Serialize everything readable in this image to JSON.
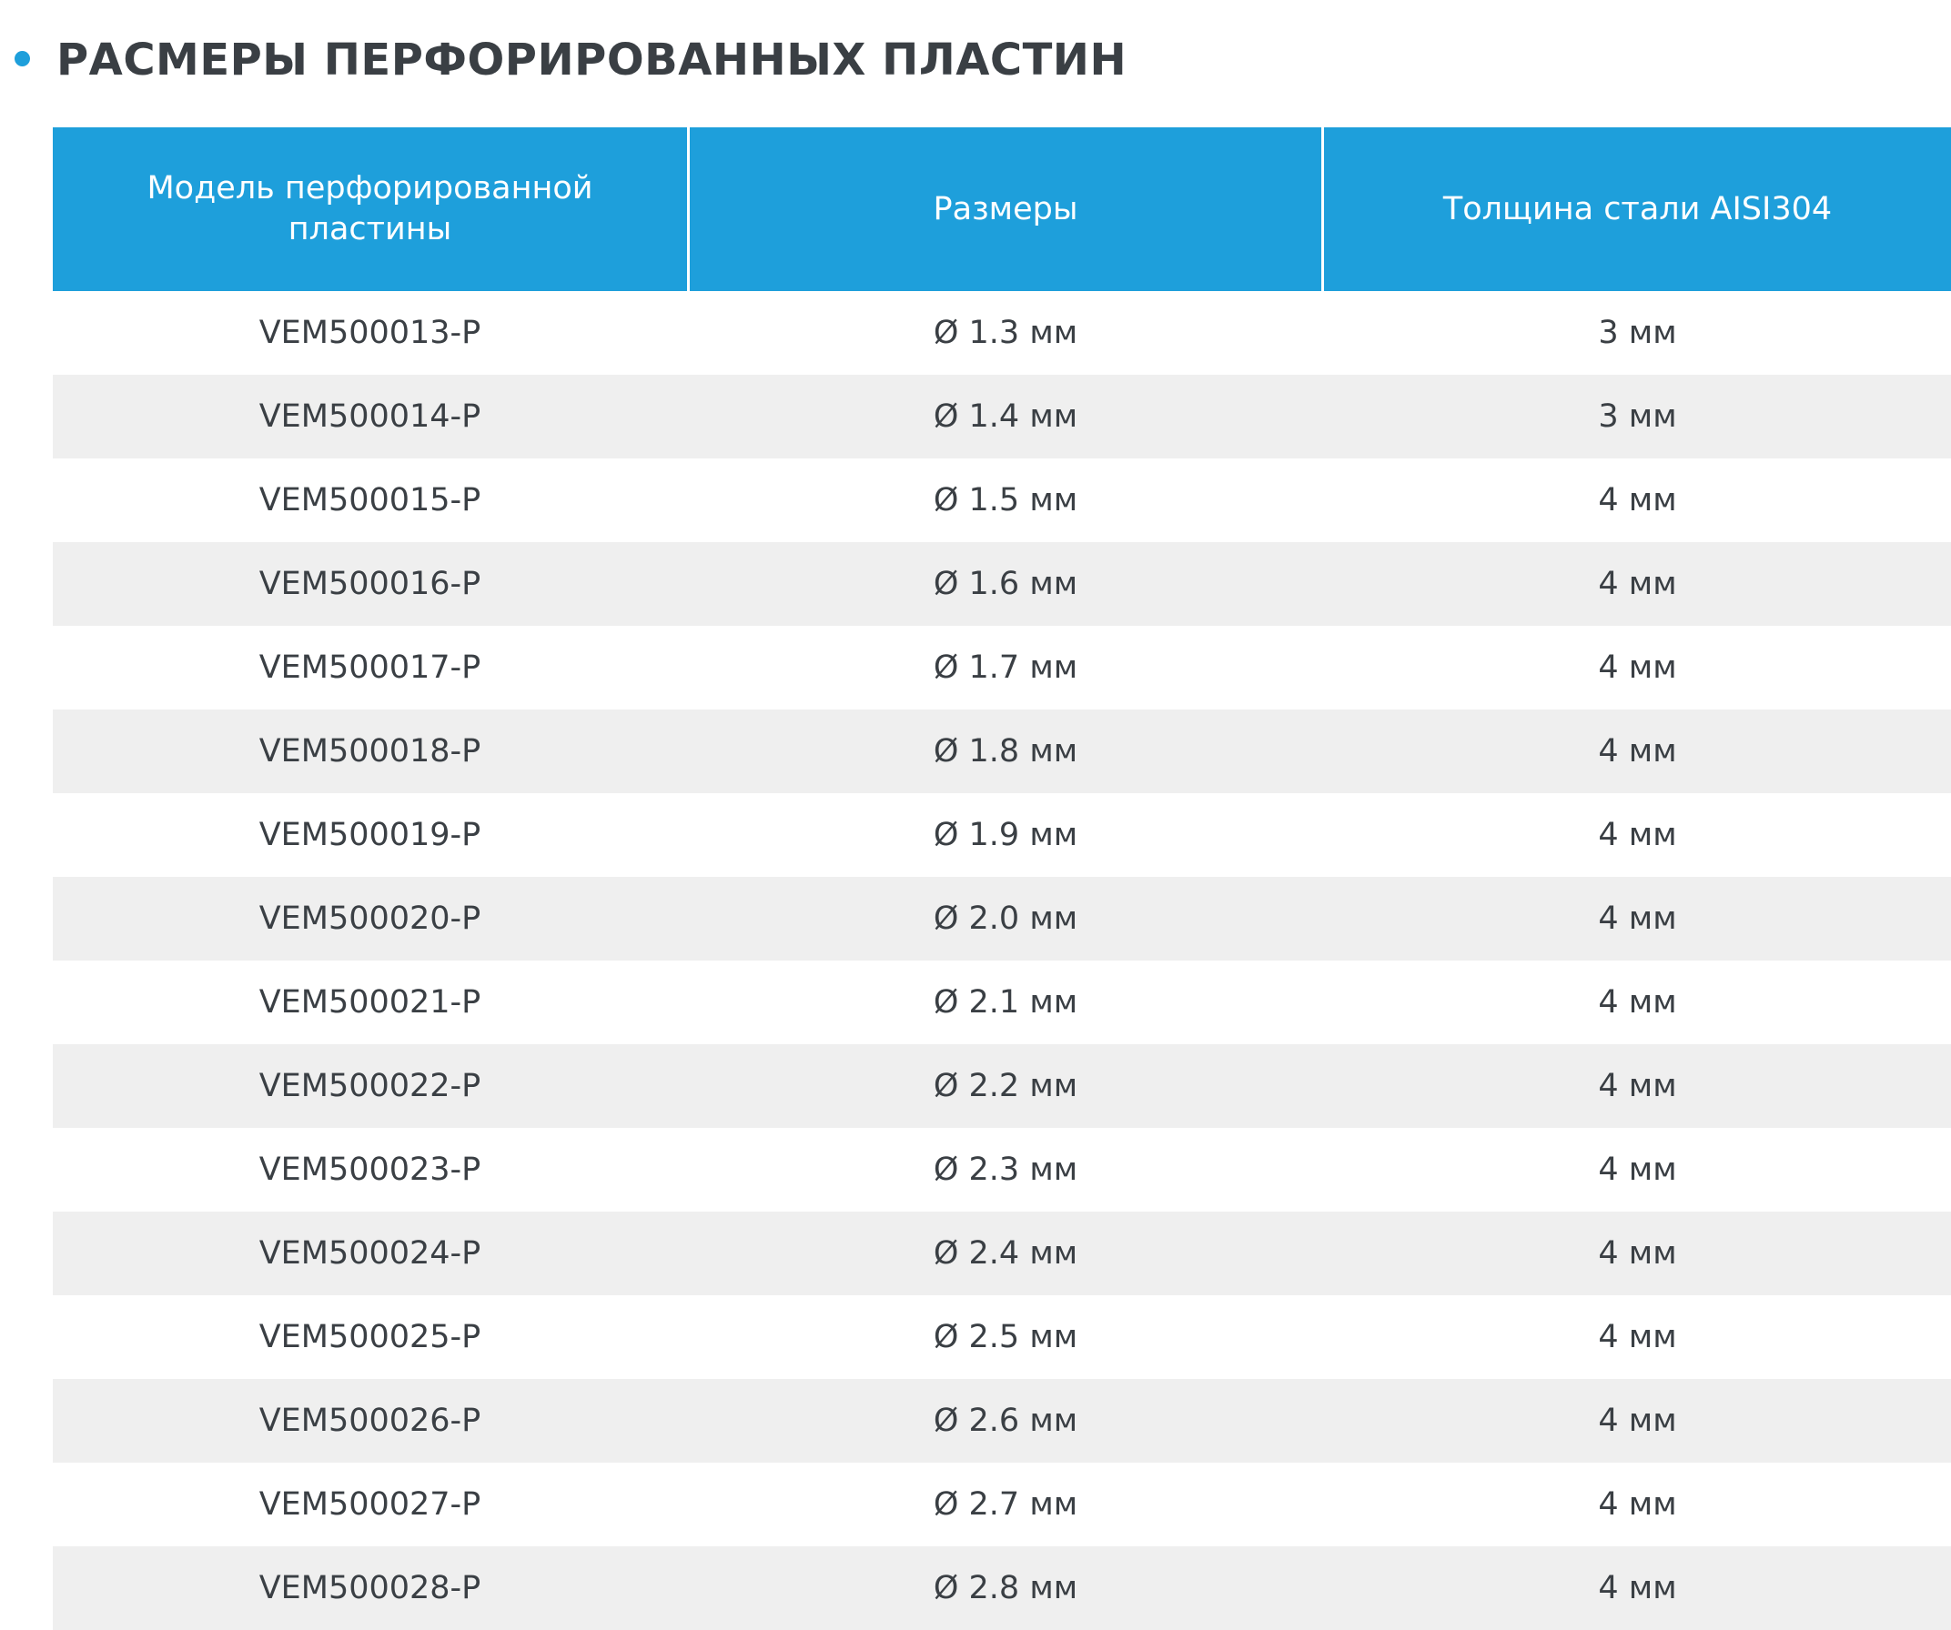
{
  "heading": {
    "title": "РАСМЕРЫ ПЕРФОРИРОВАННЫХ ПЛАСТИН",
    "bullet_color": "#1e9fdb"
  },
  "table": {
    "header_color": "#1e9fdb",
    "stripe_color": "#efefef",
    "columns": [
      "Модель перфорированной пластины",
      "Размеры",
      "Толщина стали AISI304"
    ],
    "rows": [
      [
        "VEM500013-P",
        "Ø 1.3 мм",
        "3 мм"
      ],
      [
        "VEM500014-P",
        "Ø 1.4 мм",
        "3 мм"
      ],
      [
        "VEM500015-P",
        "Ø 1.5 мм",
        "4 мм"
      ],
      [
        "VEM500016-P",
        "Ø 1.6 мм",
        "4 мм"
      ],
      [
        "VEM500017-P",
        "Ø 1.7 мм",
        "4 мм"
      ],
      [
        "VEM500018-P",
        "Ø 1.8 мм",
        "4 мм"
      ],
      [
        "VEM500019-P",
        "Ø 1.9 мм",
        "4 мм"
      ],
      [
        "VEM500020-P",
        "Ø 2.0 мм",
        "4 мм"
      ],
      [
        "VEM500021-P",
        "Ø 2.1 мм",
        "4 мм"
      ],
      [
        "VEM500022-P",
        "Ø 2.2 мм",
        "4 мм"
      ],
      [
        "VEM500023-P",
        "Ø 2.3 мм",
        "4 мм"
      ],
      [
        "VEM500024-P",
        "Ø 2.4 мм",
        "4 мм"
      ],
      [
        "VEM500025-P",
        "Ø 2.5 мм",
        "4 мм"
      ],
      [
        "VEM500026-P",
        "Ø 2.6 мм",
        "4 мм"
      ],
      [
        "VEM500027-P",
        "Ø 2.7 мм",
        "4 мм"
      ],
      [
        "VEM500028-P",
        "Ø 2.8 мм",
        "4 мм"
      ]
    ]
  }
}
